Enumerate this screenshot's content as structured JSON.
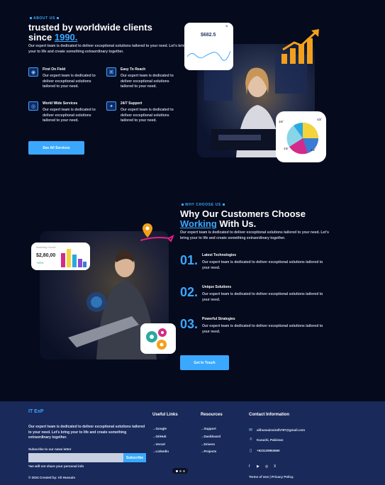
{
  "about": {
    "tag": "ABOUT US",
    "heading_line1": "trusted by worldwide clients",
    "heading_since": "since ",
    "heading_year": "1990.",
    "description": "Our expert team is dedicated to deliver exceptional solutions tailored to your need. Let's bring your to life and create something extraordinary together.",
    "features": [
      {
        "icon": "drop-icon",
        "glyph": "◉",
        "title": "First On Field",
        "text": "Our expert team is dedicated to deliver exceptional solutions tailored to your need."
      },
      {
        "icon": "gamepad-icon",
        "glyph": "⌘",
        "title": "Easy To Reach",
        "text": "Our expert team is dedicated to deliver exceptional solutions tailored to your need."
      },
      {
        "icon": "globe-icon",
        "glyph": "◎",
        "title": "World Wide Services",
        "text": "Our expert team is dedicated to deliver exceptional solutions tailored to your need."
      },
      {
        "icon": "handshake-icon",
        "glyph": "✦",
        "title": "24/7 Support",
        "text": "Our expert team is dedicated to deliver exceptional solutions tailored to your need."
      }
    ],
    "button": "See All Services",
    "price_card_value": "$682.5",
    "pie_labels": [
      "16/",
      "43/",
      "15/",
      "16/"
    ]
  },
  "why": {
    "tag": "WHY CHOOSE US",
    "heading_a": "Why Our Customers Choose",
    "heading_hl": "Working",
    "heading_b": " With Us.",
    "description": "Our expert team is dedicated to deliver exceptional solutions tailored to your need. Let's bring your to life and create something extraordinary together.",
    "stat_card": {
      "label": "Marketing Growth",
      "value": "$2,80,00",
      "change": "+20%"
    },
    "reasons": [
      {
        "num": "01.",
        "title": "Latest Technologies",
        "text": "Our expert team is dedicated to deliver exceptional solutions tailored to your need."
      },
      {
        "num": "02.",
        "title": "Unique Solutions",
        "text": "Our expert team is dedicated to deliver exceptional solutions tailored to your need."
      },
      {
        "num": "03.",
        "title": "Powerful Strategies",
        "text": "Our expert team is dedicated to deliver exceptional solutions tailored to your need."
      }
    ],
    "button": "Get In Touch"
  },
  "footer": {
    "brand": "IT ExP",
    "description": "Our expert team is dedicated to deliver exceptional solutions tailored to your need. Let's bring your to life and create something extraordinary together.",
    "newsletter_label": "Subscribe to our news letter",
    "newsletter_placeholder": "",
    "subscribe": "Subscribe",
    "note": "*we will not share your personal info",
    "useful_title": "Useful Links",
    "useful_links": [
      "Google",
      "GitHub",
      "Vercel",
      "Linkedin"
    ],
    "resources_title": "Resources",
    "resources_links": [
      "Support",
      "Dashboard",
      "Drivers",
      "Projects"
    ],
    "contact_title": "Contact Information",
    "email": "alihussainsindh787@gmail.com",
    "location": "Karachi, Pakistan",
    "phone": "+923129963660",
    "copyright": "© 2024 Created by: Ali Hussain",
    "legal": "Terms of Use | Privacy Policy."
  },
  "colors": {
    "accent": "#3aa8ff",
    "background": "#050a1c",
    "footer": "#18295a"
  }
}
